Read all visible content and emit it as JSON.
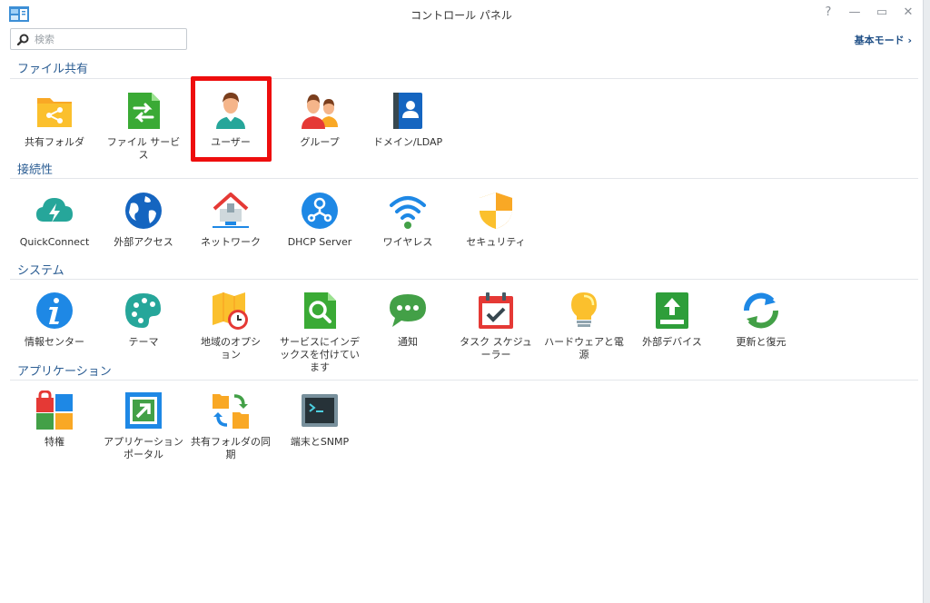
{
  "window": {
    "title": "コントロール パネル",
    "help_label": "?",
    "minimize_label": "—",
    "maximize_label": "▭",
    "close_label": "✕"
  },
  "search": {
    "placeholder": "検索"
  },
  "basic_mode": {
    "label": "基本モード ›"
  },
  "sections": [
    {
      "title": "ファイル共有",
      "items": [
        {
          "label": "共有フォルダ",
          "icon": "shared-folder-icon"
        },
        {
          "label": "ファイル サービス",
          "icon": "file-services-icon"
        },
        {
          "label": "ユーザー",
          "icon": "user-icon"
        },
        {
          "label": "グループ",
          "icon": "group-icon"
        },
        {
          "label": "ドメイン/LDAP",
          "icon": "domain-ldap-icon"
        }
      ]
    },
    {
      "title": "接続性",
      "items": [
        {
          "label": "QuickConnect",
          "icon": "quickconnect-icon"
        },
        {
          "label": "外部アクセス",
          "icon": "external-access-icon"
        },
        {
          "label": "ネットワーク",
          "icon": "network-icon"
        },
        {
          "label": "DHCP Server",
          "icon": "dhcp-server-icon"
        },
        {
          "label": "ワイヤレス",
          "icon": "wireless-icon"
        },
        {
          "label": "セキュリティ",
          "icon": "security-icon"
        }
      ]
    },
    {
      "title": "システム",
      "items": [
        {
          "label": "情報センター",
          "icon": "info-center-icon"
        },
        {
          "label": "テーマ",
          "icon": "theme-icon"
        },
        {
          "label": "地域のオプション",
          "icon": "regional-options-icon"
        },
        {
          "label": "サービスにインデックスを付けています",
          "icon": "indexing-service-icon"
        },
        {
          "label": "通知",
          "icon": "notification-icon"
        },
        {
          "label": "タスク スケジューラー",
          "icon": "task-scheduler-icon"
        },
        {
          "label": "ハードウェアと電源",
          "icon": "hardware-power-icon"
        },
        {
          "label": "外部デバイス",
          "icon": "external-devices-icon"
        },
        {
          "label": "更新と復元",
          "icon": "update-restore-icon"
        }
      ]
    },
    {
      "title": "アプリケーション",
      "items": [
        {
          "label": "特権",
          "icon": "privileges-icon"
        },
        {
          "label": "アプリケーションポータル",
          "icon": "application-portal-icon"
        },
        {
          "label": "共有フォルダの同期",
          "icon": "shared-folder-sync-icon"
        },
        {
          "label": "端末とSNMP",
          "icon": "terminal-snmp-icon"
        }
      ]
    }
  ],
  "colors": {
    "section_title": "#2b5d93",
    "highlight_border": "#ee0d0d"
  }
}
